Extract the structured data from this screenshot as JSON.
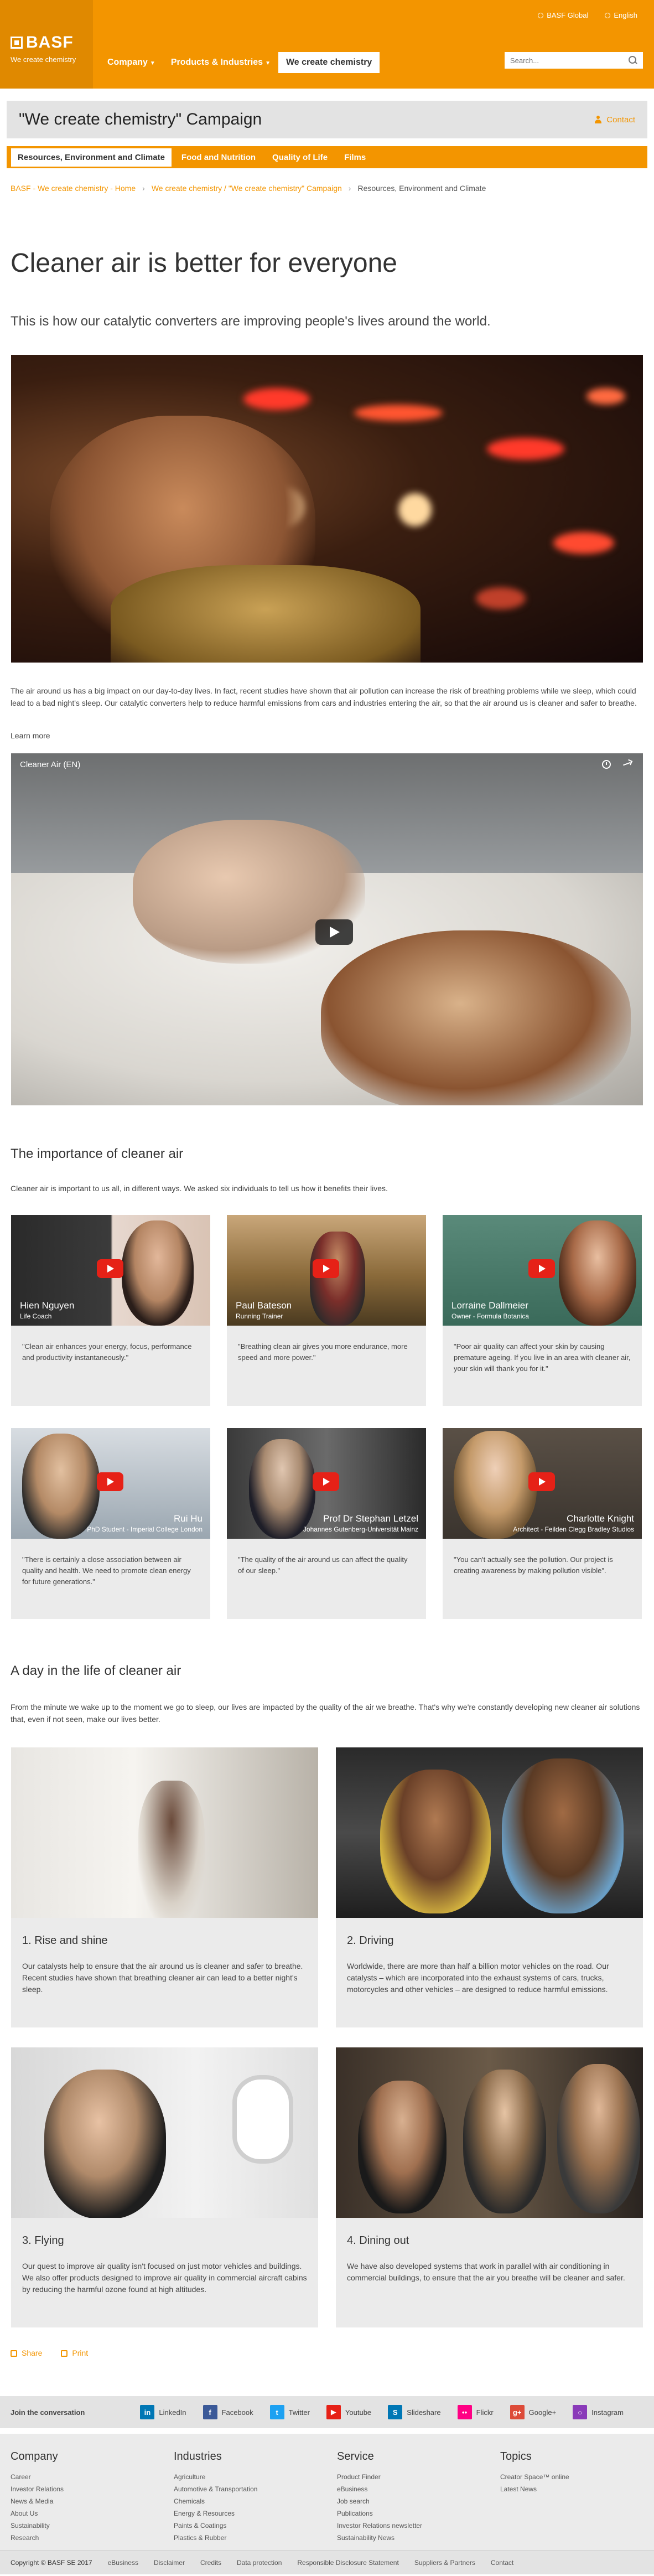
{
  "header": {
    "logo_text": "BASF",
    "logo_sub": "We create chemistry",
    "top_links": [
      "BASF Global",
      "English"
    ],
    "nav": [
      {
        "label": "Company",
        "active": false
      },
      {
        "label": "Products & Industries",
        "active": false
      },
      {
        "label": "We create chemistry",
        "active": true
      }
    ],
    "search_placeholder": "Search..."
  },
  "campaign": {
    "title": "\"We create chemistry\" Campaign",
    "contact": "Contact"
  },
  "sub_nav": [
    {
      "label": "Resources, Environment and Climate",
      "active": true
    },
    {
      "label": "Food and Nutrition",
      "active": false
    },
    {
      "label": "Quality of Life",
      "active": false
    },
    {
      "label": "Films",
      "active": false
    }
  ],
  "breadcrumb": [
    "BASF - We create chemistry - Home",
    "We create chemistry / \"We create chemistry\" Campaign",
    "Resources, Environment and Climate"
  ],
  "main": {
    "title": "Cleaner air is better for everyone",
    "intro": "This is how our catalytic converters are improving people's lives around the world.",
    "body": "The air around us has a big impact on our day-to-day lives. In fact, recent studies have shown that air pollution can increase the risk of breathing problems while we sleep, which could lead to a bad night's sleep. Our catalytic converters help to reduce harmful emissions from cars and industries entering the air, so that the air around us is cleaner and safer to breathe.",
    "learn_more": "Learn more",
    "video_title": "Cleaner Air (EN)"
  },
  "importance": {
    "title": "The importance of cleaner air",
    "intro": "Cleaner air is important to us all, in different ways. We asked six individuals to tell us how it benefits their lives.",
    "testimonials": [
      {
        "name": "Hien Nguyen",
        "role": "Life Coach",
        "quote": "\"Clean air enhances your energy, focus, performance and productivity instantaneously.\""
      },
      {
        "name": "Paul Bateson",
        "role": "Running Trainer",
        "quote": "\"Breathing clean air gives you more endurance, more speed and more power.\""
      },
      {
        "name": "Lorraine Dallmeier",
        "role": "Owner - Formula Botanica",
        "quote": "\"Poor air quality can affect your skin by causing premature ageing. If you live in an area with cleaner air, your skin will thank you for it.\""
      },
      {
        "name": "Rui Hu",
        "role": "PhD Student - Imperial College London",
        "quote": "\"There is certainly a close association between air quality and health. We need to promote clean energy for future generations.\""
      },
      {
        "name": "Prof Dr Stephan Letzel",
        "role": "Johannes Gutenberg-Universität Mainz",
        "quote": "\"The quality of the air around us can affect the quality of our sleep.\""
      },
      {
        "name": "Charlotte Knight",
        "role": "Architect - Feilden Clegg Bradley Studios",
        "quote": "\"You can't actually see the pollution. Our project is creating awareness by making pollution visible\"."
      }
    ]
  },
  "day": {
    "title": "A day in the life of cleaner air",
    "intro": "From the minute we wake up to the moment we go to sleep, our lives are impacted by the quality of the air we breathe. That's why we're constantly developing new cleaner air solutions that, even if not seen, make our lives better.",
    "cards": [
      {
        "title": "1. Rise and shine",
        "text": "Our catalysts help to ensure that the air around us is cleaner and safer to breathe. Recent studies have shown that breathing cleaner air can lead to a better night's sleep."
      },
      {
        "title": "2. Driving",
        "text": "Worldwide, there are more than half a billion motor vehicles on the road. Our catalysts – which are incorporated into the exhaust systems of cars, trucks, motorcycles and other vehicles – are designed to reduce harmful emissions."
      },
      {
        "title": "3. Flying",
        "text": "Our quest to improve air quality isn't focused on just motor vehicles and buildings. We also offer products designed to improve air quality in commercial aircraft cabins by reducing the harmful ozone found at high altitudes."
      },
      {
        "title": "4. Dining out",
        "text": "We have also developed systems that work in parallel with air conditioning in commercial buildings, to ensure that the air you breathe will be cleaner and safer."
      }
    ]
  },
  "actions": {
    "share": "Share",
    "print": "Print"
  },
  "social": {
    "join": "Join the conversation",
    "items": [
      {
        "label": "LinkedIn",
        "glyph": "in",
        "color": "#0077b5"
      },
      {
        "label": "Facebook",
        "glyph": "f",
        "color": "#3b5998"
      },
      {
        "label": "Twitter",
        "glyph": "t",
        "color": "#1da1f2"
      },
      {
        "label": "Youtube",
        "glyph": "▶",
        "color": "#e62117"
      },
      {
        "label": "Slideshare",
        "glyph": "S",
        "color": "#0077b5"
      },
      {
        "label": "Flickr",
        "glyph": "••",
        "color": "#ff0084"
      },
      {
        "label": "Google+",
        "glyph": "g+",
        "color": "#dd4b39"
      },
      {
        "label": "Instagram",
        "glyph": "○",
        "color": "#8a3ab9"
      }
    ]
  },
  "footer": {
    "columns": [
      {
        "head": "Company",
        "links": [
          "Career",
          "Investor Relations",
          "News & Media",
          "About Us",
          "Sustainability",
          "Research"
        ]
      },
      {
        "head": "Industries",
        "links": [
          "Agriculture",
          "Automotive & Transportation",
          "Chemicals",
          "Energy & Resources",
          "Paints & Coatings",
          "Plastics & Rubber"
        ]
      },
      {
        "head": "Service",
        "links": [
          "Product Finder",
          "eBusiness",
          "Job search",
          "Publications",
          "Investor Relations newsletter",
          "Sustainability News"
        ]
      },
      {
        "head": "Topics",
        "links": [
          "Creator Space™ online",
          "Latest News"
        ]
      }
    ],
    "bottom": [
      "Copyright © BASF SE 2017",
      "eBusiness",
      "Disclaimer",
      "Credits",
      "Data protection",
      "Responsible Disclosure Statement",
      "Suppliers & Partners",
      "Contact"
    ]
  }
}
